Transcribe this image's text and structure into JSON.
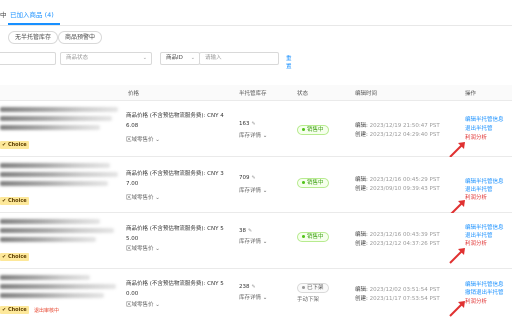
{
  "tabs": [
    {
      "label": "中"
    },
    {
      "label": "已加入商品 (4)"
    }
  ],
  "filters": [
    "无半托管库存",
    "商品预警中"
  ],
  "search": {
    "status_placeholder": "商品状态",
    "id_select": "商品ID",
    "input_placeholder": "请输入",
    "reset": "重置"
  },
  "columns": [
    "价格",
    "半托管库存",
    "状态",
    "编辑时间",
    "操作"
  ],
  "rows": [
    {
      "price_lines": [
        "商品价格 (不含预估物流服务费): CNY 4",
        "6.08"
      ],
      "region": "区域零售价",
      "stock": "163",
      "stock_detail": "库存详情",
      "status": "销售中",
      "edit_label": "编辑:",
      "edit_time": "2023/12/19 21:50:47 PST",
      "create_label": "创建:",
      "create_time": "2023/12/12 04:29:40 PST",
      "choice": "Choice",
      "ops": [
        "编辑半托管信息",
        "退出半托管",
        "利润分析"
      ]
    },
    {
      "price_lines": [
        "商品价格 (不含预估物流服务费): CNY 3",
        "7.00"
      ],
      "region": "区域零售价",
      "stock": "709",
      "stock_detail": "库存详情",
      "status": "销售中",
      "edit_label": "编辑:",
      "edit_time": "2023/12/16 00:45:29 PST",
      "create_label": "创建:",
      "create_time": "2023/09/10 09:39:43 PST",
      "choice": "Choice",
      "ops": [
        "编辑半托管信息",
        "退出半托管",
        "利润分析"
      ]
    },
    {
      "price_lines": [
        "商品价格 (不含预估物流服务费): CNY 5",
        "5.00"
      ],
      "region": "区域零售价",
      "stock": "38",
      "stock_detail": "库存详情",
      "status": "销售中",
      "edit_label": "编辑:",
      "edit_time": "2023/12/16 00:43:39 PST",
      "create_label": "创建:",
      "create_time": "2023/12/12 04:37:26 PST",
      "choice": "Choice",
      "ops": [
        "编辑半托管信息",
        "退出半托管",
        "利润分析"
      ]
    },
    {
      "price_lines": [
        "商品价格 (不含预估物流服务费): CNY 5",
        "0.00"
      ],
      "region": "区域零售价",
      "stock": "238",
      "stock_detail": "库存详情",
      "status": "已下架",
      "manual": "手动下架",
      "edit_label": "编辑:",
      "edit_time": "2023/12/02 03:51:54 PST",
      "create_label": "创建:",
      "create_time": "2023/11/17 07:53:54 PST",
      "choice": "Choice",
      "pending": "退出审核中",
      "ops": [
        "编辑半托管信息",
        "撤销退出半托管",
        "利润分析"
      ]
    }
  ],
  "colors": {
    "accent": "#1890ff",
    "success": "#52c41a",
    "danger": "#e03131",
    "choice_bg": "#fde89a"
  }
}
